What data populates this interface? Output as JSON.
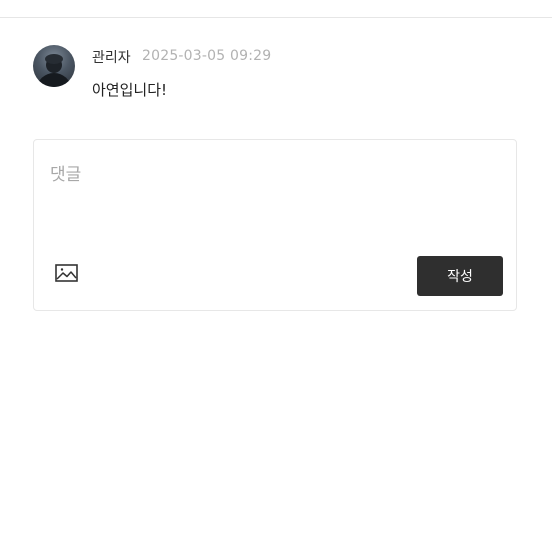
{
  "comment": {
    "author": "관리자",
    "timestamp": "2025-03-05 09:29",
    "body": "아연입니다!",
    "avatar_icon": "user-avatar-photo"
  },
  "reply_form": {
    "placeholder": "댓글",
    "value": "",
    "image_icon": "image-icon",
    "submit_label": "작성"
  },
  "colors": {
    "submit_button": "#2f2f2f",
    "timestamp": "#b2b2b2",
    "border": "#e7e7e7"
  }
}
